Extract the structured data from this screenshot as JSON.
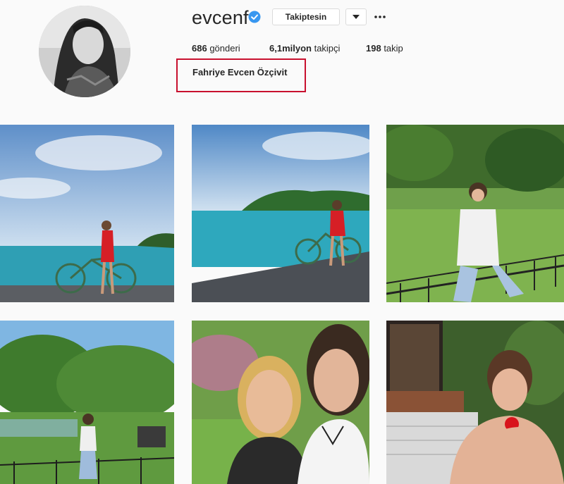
{
  "profile": {
    "username": "evcenf",
    "verified": true,
    "follow_button_label": "Takiptesin",
    "dropdown_icon": "chevron-down-icon",
    "more_icon": "ellipsis-icon",
    "full_name": "Fahriye Evcen Özçivit"
  },
  "stats": {
    "posts_count": "686",
    "posts_label": " gönderi",
    "followers_count": "6,1milyon",
    "followers_label": " takipçi",
    "following_count": "198",
    "following_label": " takip"
  },
  "colors": {
    "verified_badge": "#3897f0",
    "highlight_box": "#c8102e",
    "background": "#fafafa"
  },
  "posts": [
    {
      "subject": "woman on bicycle by the sea"
    },
    {
      "subject": "woman on bicycle on island pier"
    },
    {
      "subject": "woman sitting on fence in garden"
    },
    {
      "subject": "woman standing in park"
    },
    {
      "subject": "selfie of two women"
    },
    {
      "subject": "woman with red flower"
    }
  ]
}
